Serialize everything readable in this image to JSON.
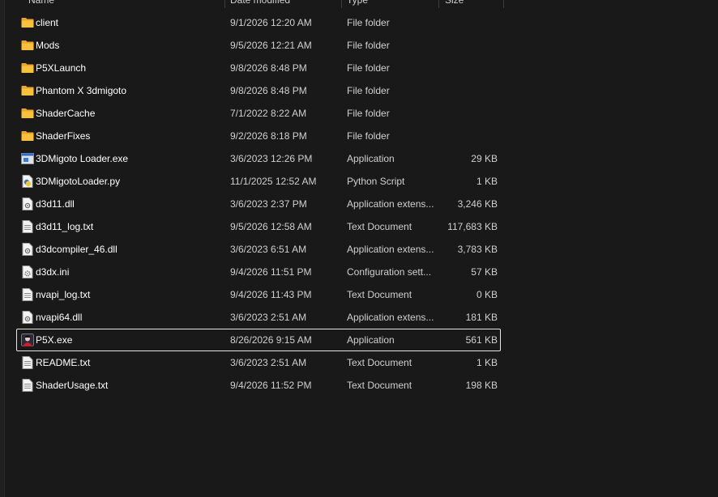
{
  "columns": {
    "name": "Name",
    "date": "Date modified",
    "type": "Type",
    "size": "Size"
  },
  "files": [
    {
      "icon": "folder-icon",
      "name": "client",
      "date": "9/1/2026 12:20 AM",
      "type": "File folder",
      "size": "",
      "selected": false
    },
    {
      "icon": "folder-icon",
      "name": "Mods",
      "date": "9/5/2026 12:21 AM",
      "type": "File folder",
      "size": "",
      "selected": false
    },
    {
      "icon": "folder-icon",
      "name": "P5XLaunch",
      "date": "9/8/2026 8:48 PM",
      "type": "File folder",
      "size": "",
      "selected": false
    },
    {
      "icon": "folder-icon",
      "name": "Phantom X 3dmigoto",
      "date": "9/8/2026 8:48 PM",
      "type": "File folder",
      "size": "",
      "selected": false
    },
    {
      "icon": "folder-icon",
      "name": "ShaderCache",
      "date": "7/1/2022 8:22 AM",
      "type": "File folder",
      "size": "",
      "selected": false
    },
    {
      "icon": "folder-icon",
      "name": "ShaderFixes",
      "date": "9/2/2026 8:18 PM",
      "type": "File folder",
      "size": "",
      "selected": false
    },
    {
      "icon": "application-icon",
      "name": "3DMigoto Loader.exe",
      "date": "3/6/2023 12:26 PM",
      "type": "Application",
      "size": "29 KB",
      "selected": false
    },
    {
      "icon": "python-file-icon",
      "name": "3DMigotoLoader.py",
      "date": "11/1/2025 12:52 AM",
      "type": "Python Script",
      "size": "1 KB",
      "selected": false
    },
    {
      "icon": "dll-file-icon",
      "name": "d3d11.dll",
      "date": "3/6/2023 2:37 PM",
      "type": "Application extens...",
      "size": "3,246 KB",
      "selected": false
    },
    {
      "icon": "text-file-icon",
      "name": "d3d11_log.txt",
      "date": "9/5/2026 12:58 AM",
      "type": "Text Document",
      "size": "117,683 KB",
      "selected": false
    },
    {
      "icon": "dll-file-icon",
      "name": "d3dcompiler_46.dll",
      "date": "3/6/2023 6:51 AM",
      "type": "Application extens...",
      "size": "3,783 KB",
      "selected": false
    },
    {
      "icon": "config-file-icon",
      "name": "d3dx.ini",
      "date": "9/4/2026 11:51 PM",
      "type": "Configuration sett...",
      "size": "57 KB",
      "selected": false
    },
    {
      "icon": "text-file-icon",
      "name": "nvapi_log.txt",
      "date": "9/4/2026 11:43 PM",
      "type": "Text Document",
      "size": "0 KB",
      "selected": false
    },
    {
      "icon": "dll-file-icon",
      "name": "nvapi64.dll",
      "date": "3/6/2023 2:51 AM",
      "type": "Application extens...",
      "size": "181 KB",
      "selected": false
    },
    {
      "icon": "game-app-icon",
      "name": "P5X.exe",
      "date": "8/26/2026 9:15 AM",
      "type": "Application",
      "size": "561 KB",
      "selected": true
    },
    {
      "icon": "text-file-icon",
      "name": "README.txt",
      "date": "3/6/2023 2:51 AM",
      "type": "Text Document",
      "size": "1 KB",
      "selected": false
    },
    {
      "icon": "text-file-icon",
      "name": "ShaderUsage.txt",
      "date": "9/4/2026 11:52 PM",
      "type": "Text Document",
      "size": "198 KB",
      "selected": false
    }
  ],
  "colors": {
    "background": "#191919",
    "folder": "#f8c13c",
    "text": "#ffffff",
    "secondary_text": "#d0d0d0",
    "selection_border": "#e6e6e6"
  }
}
